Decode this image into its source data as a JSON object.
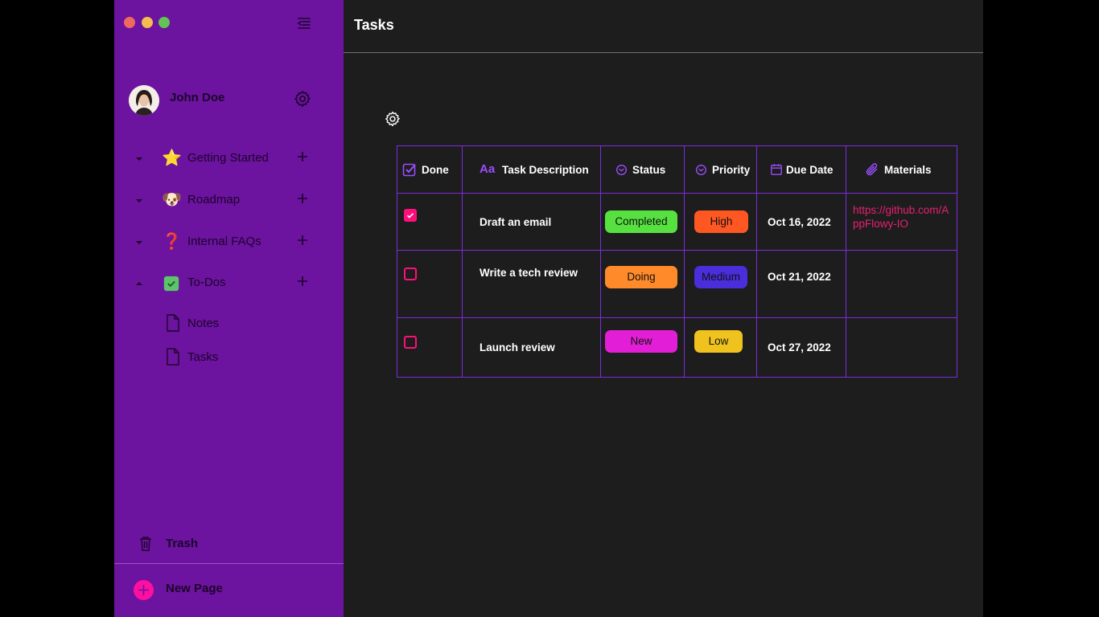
{
  "sidebar": {
    "user_name": "John Doe",
    "items": [
      {
        "icon": "star-icon",
        "emoji": "⭐",
        "label": "Getting Started",
        "expanded": false
      },
      {
        "icon": "dog-icon",
        "emoji": "🐶",
        "label": "Roadmap",
        "expanded": false
      },
      {
        "icon": "question-icon",
        "emoji": "❓",
        "label": "Internal FAQs",
        "expanded": false
      },
      {
        "icon": "checkbox-icon",
        "emoji": "",
        "label": "To-Dos",
        "expanded": true
      }
    ],
    "subitems": [
      {
        "icon": "document-icon",
        "label": "Notes"
      },
      {
        "icon": "document-icon",
        "label": "Tasks"
      }
    ],
    "trash_label": "Trash",
    "new_page_label": "New Page",
    "colors": {
      "sidebar": "#6c13a0",
      "accent": "#ff0fa0"
    }
  },
  "main": {
    "title": "Tasks"
  },
  "grid": {
    "columns": [
      {
        "icon": "checkbox-icon",
        "label": "Done"
      },
      {
        "icon": "text-icon",
        "label": "Task Description"
      },
      {
        "icon": "select-icon",
        "label": "Status"
      },
      {
        "icon": "select-icon",
        "label": "Priority"
      },
      {
        "icon": "calendar-icon",
        "label": "Due Date"
      },
      {
        "icon": "paperclip-icon",
        "label": "Materials"
      }
    ],
    "rows": [
      {
        "done": true,
        "task": "Draft an email",
        "status": "Completed",
        "status_color": "#57e141",
        "priority": "High",
        "priority_color": "#ff5722",
        "due": "Oct 16, 2022",
        "materials": "https://github.com/AppFlowy-IO"
      },
      {
        "done": false,
        "task": "Write a tech review",
        "status": "Doing",
        "status_color": "#ff8a2a",
        "priority": "Medium",
        "priority_color": "#4a2ddb",
        "due": "Oct 21, 2022",
        "materials": ""
      },
      {
        "done": false,
        "task": "Launch review",
        "status": "New",
        "status_color": "#e21fd6",
        "priority": "Low",
        "priority_color": "#f0c21e",
        "due": "Oct 27, 2022",
        "materials": ""
      }
    ]
  }
}
